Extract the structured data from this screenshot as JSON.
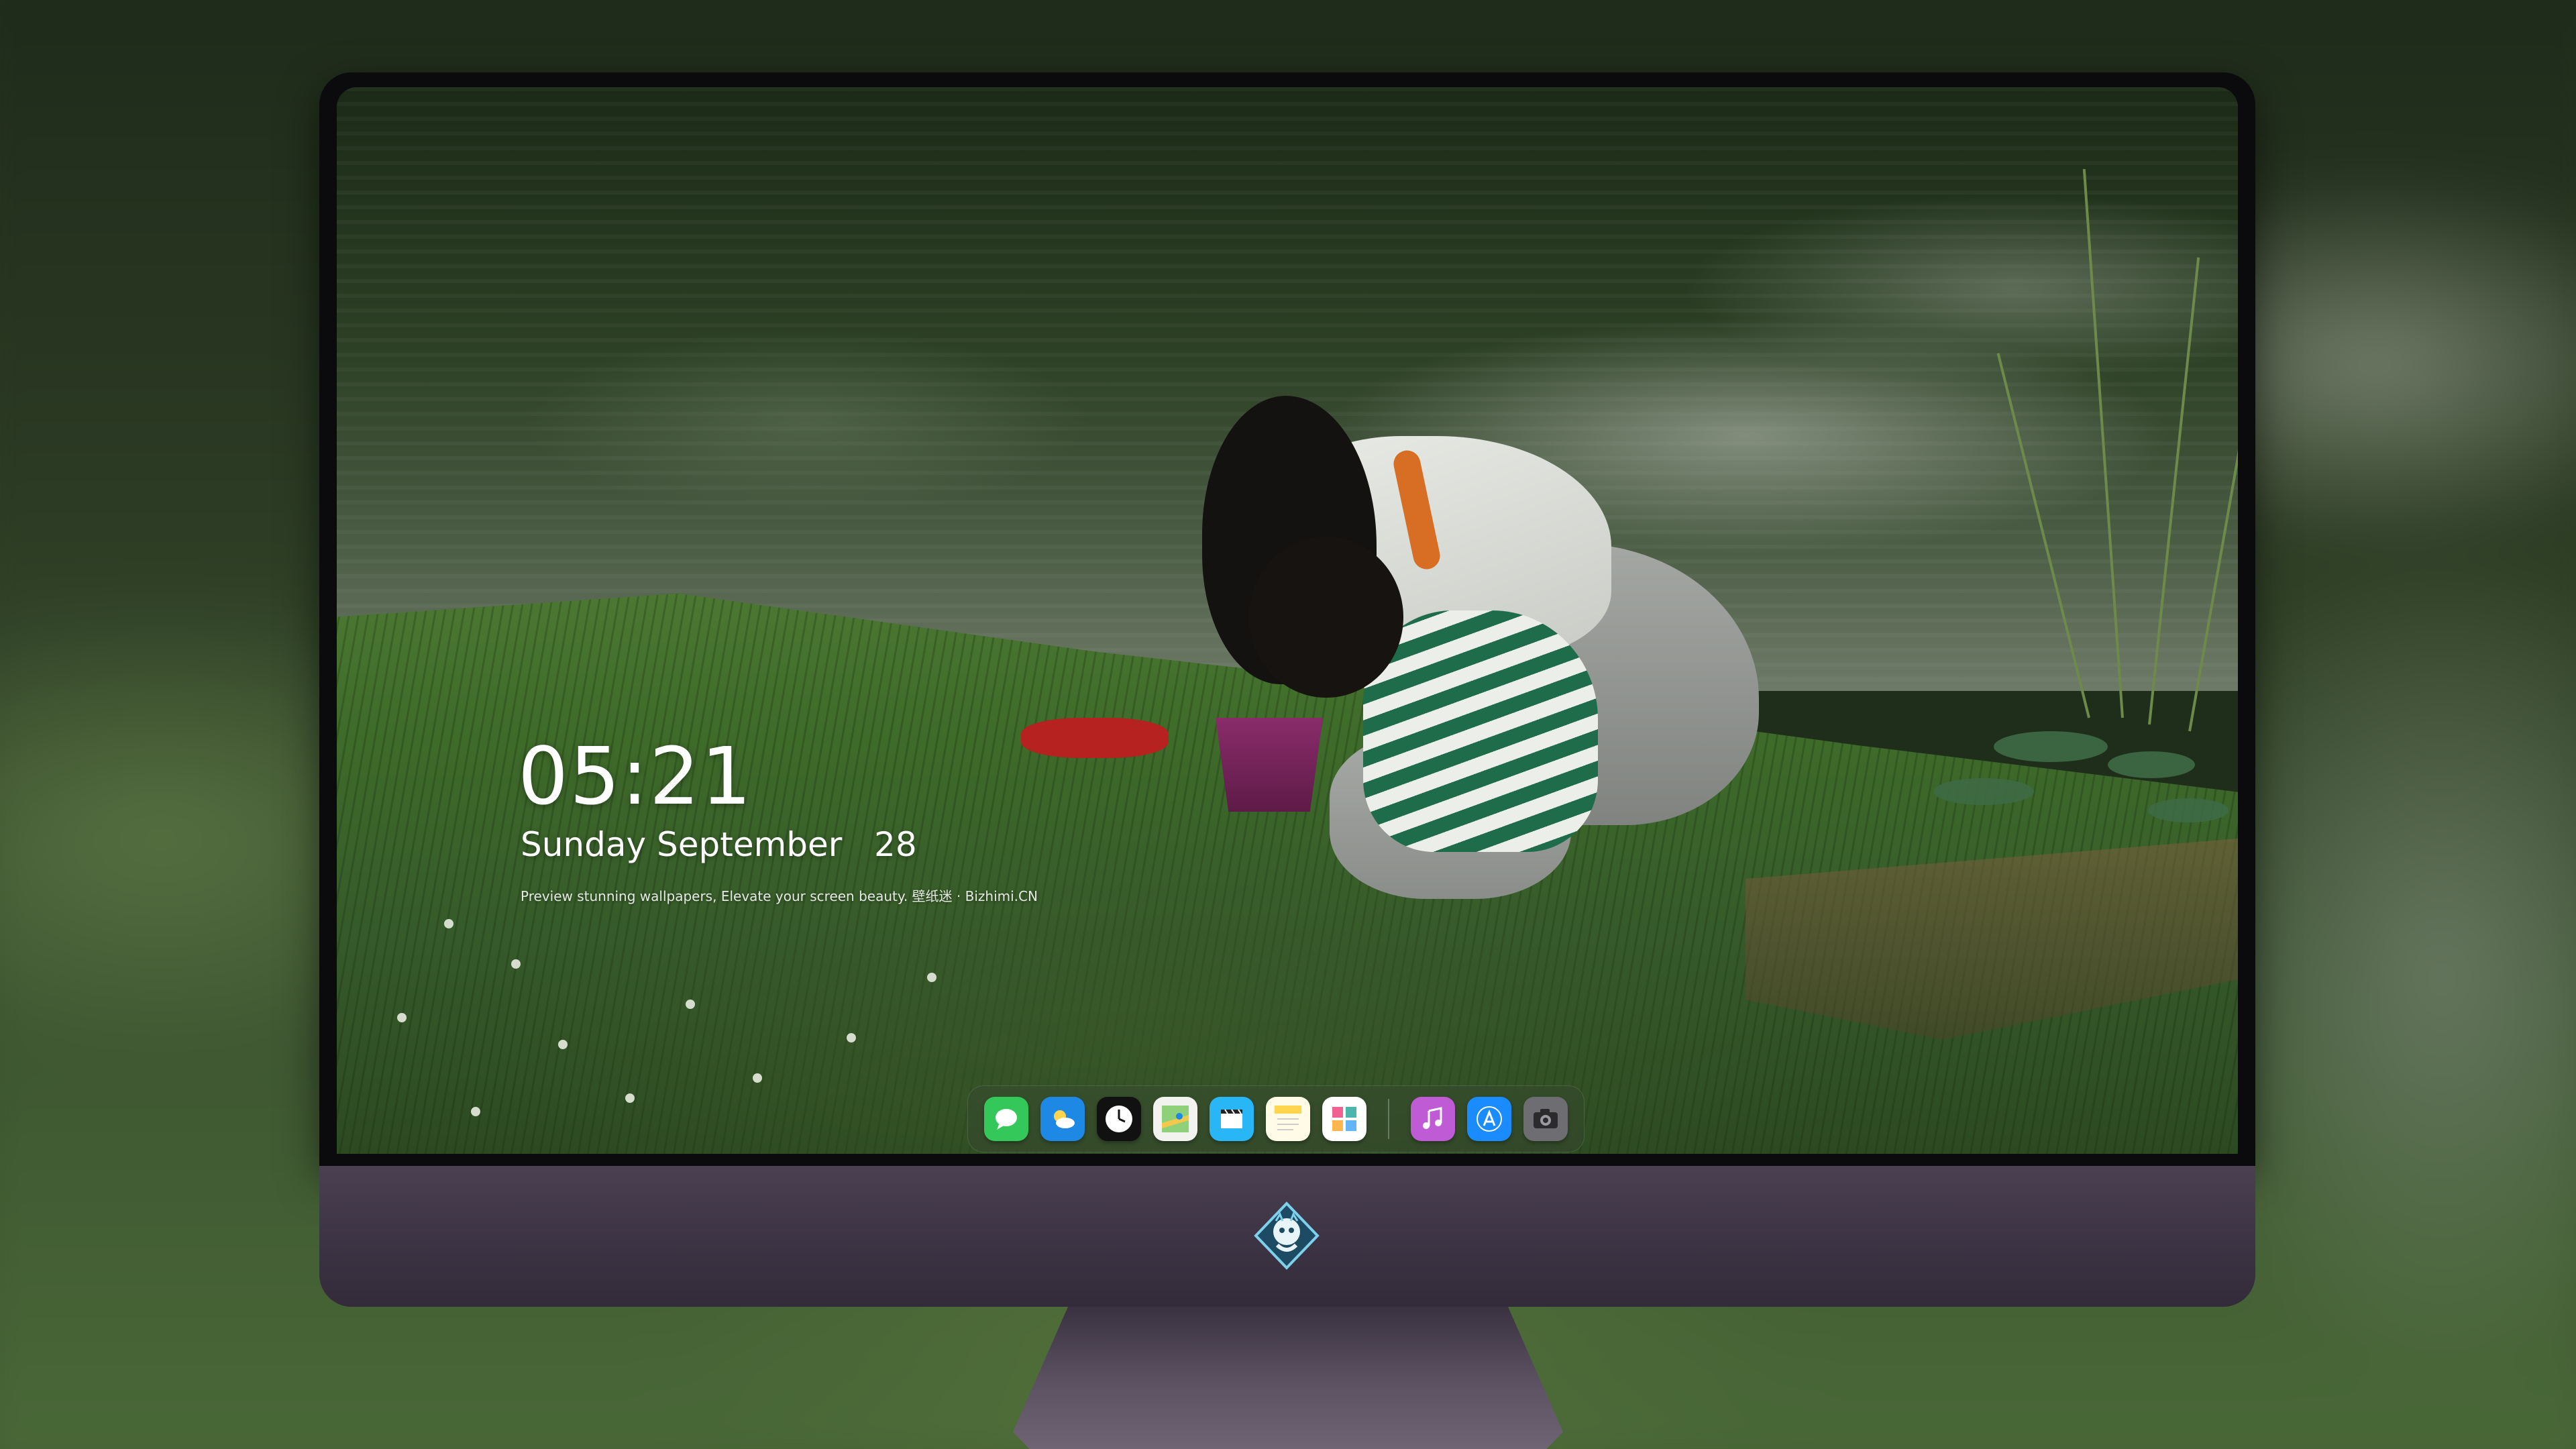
{
  "lockscreen": {
    "time": "05:21",
    "date": "Sunday September   28",
    "tagline": "Preview stunning wallpapers, Elevate your screen beauty. 壁纸迷 · Bizhimi.CN"
  },
  "dock": {
    "apps": [
      {
        "name": "messages",
        "color": "#34c759"
      },
      {
        "name": "weather",
        "color": "#1e88e5"
      },
      {
        "name": "clock",
        "color": "#111111"
      },
      {
        "name": "maps",
        "color": "#f2c94c"
      },
      {
        "name": "clips",
        "color": "#29b6f6"
      },
      {
        "name": "notes",
        "color": "#ffd54f"
      },
      {
        "name": "photo-collage",
        "color": "#4db6ac"
      },
      {
        "name": "music",
        "color": "#c05bd6"
      },
      {
        "name": "app-store",
        "color": "#1a8cff"
      },
      {
        "name": "camera",
        "color": "#6d6d72"
      }
    ]
  },
  "colors": {
    "chin": "#3f3647",
    "bezel": "#0b0b0d",
    "text": "#ffffff"
  }
}
